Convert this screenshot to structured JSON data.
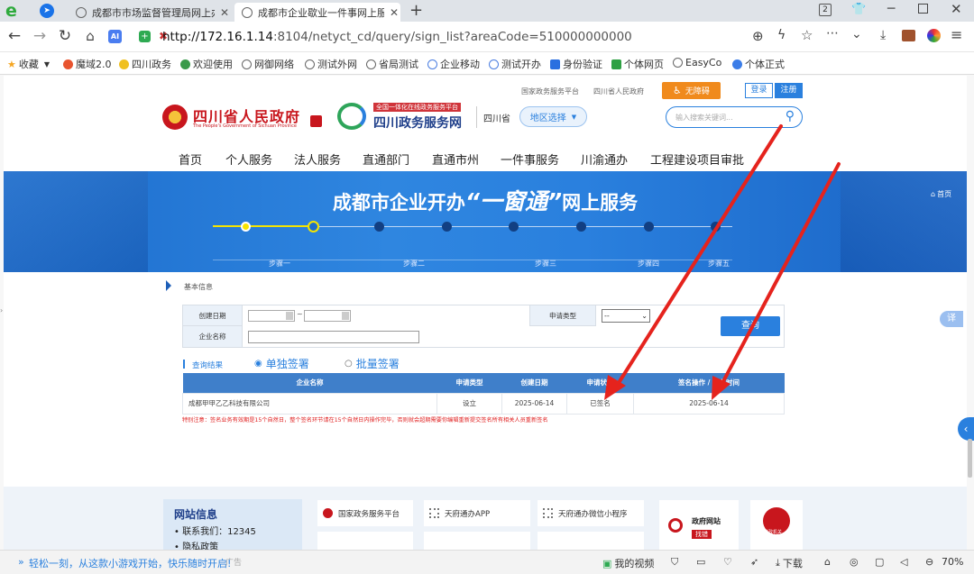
{
  "tabs": [
    {
      "title": "成都市市场监督管理局网上办事"
    },
    {
      "title": "成都市企业歇业一件事网上服务"
    }
  ],
  "window": {
    "new_tab": "+",
    "tab_count": "2"
  },
  "addressbar": {
    "url_bold": "http://172.16.1.14",
    "url_rest": ":8104/netyct_cd/query/sign_list?areaCode=510000000000"
  },
  "bookmarks": [
    {
      "label": "收藏",
      "icon": "star-icon"
    },
    {
      "label": "魔域2.0",
      "icon": "game-icon"
    },
    {
      "label": "四川政务",
      "icon": "gov-icon"
    },
    {
      "label": "欢迎使用",
      "icon": "shield-icon"
    },
    {
      "label": "网御网络",
      "icon": "globe-icon"
    },
    {
      "label": "测试外网",
      "icon": "globe-icon"
    },
    {
      "label": "省局测试",
      "icon": "globe-icon"
    },
    {
      "label": "企业移动",
      "icon": "globe-icon"
    },
    {
      "label": "测试开办",
      "icon": "globe-icon"
    },
    {
      "label": "身份验证",
      "icon": "id-icon"
    },
    {
      "label": "个体网页",
      "icon": "doc-icon"
    },
    {
      "label": "EasyCo",
      "icon": "globe-icon"
    },
    {
      "label": "个体正式",
      "icon": "person-icon"
    }
  ],
  "site": {
    "top_links": [
      "国家政务服务平台",
      "四川省人民政府"
    ],
    "accessibility": "无障碍",
    "login": "登录",
    "register": "注册",
    "gov_name": "四川省人民政府",
    "gov_name_en": "The People's Government of Sichuan Province",
    "platform_tag": "全国一体化在线政务服务平台",
    "platform_name": "四川政务服务网",
    "province": "四川省",
    "region_select": "地区选择",
    "search_placeholder": "输入搜索关键词...",
    "nav": [
      "首页",
      "个人服务",
      "法人服务",
      "直通部门",
      "直通市州",
      "一件事服务",
      "川渝通办",
      "工程建设项目审批"
    ]
  },
  "banner": {
    "title_a": "成都市企业开办",
    "title_b": "“一窗通”",
    "title_c": "网上服务",
    "home": "首页",
    "steps": [
      "步骤一",
      "步骤二",
      "步骤三",
      "步骤四",
      "步骤五"
    ]
  },
  "query": {
    "section": "基本信息",
    "created_date_label": "创建日期",
    "date_sep": "~",
    "apply_type_label": "申请类型",
    "apply_type_value": "--",
    "company_label": "企业名称",
    "search_button": "查询",
    "results_label": "查询结果",
    "mode_single": "单独签署",
    "mode_batch": "批量签署",
    "translate": "译"
  },
  "results": {
    "headers": [
      "企业名称",
      "申请类型",
      "创建日期",
      "申请状态",
      "签名操作 / 签名时间"
    ],
    "rows": [
      [
        "成都甲甲乙乙科技有限公司",
        "设立",
        "2025-06-14",
        "已签名",
        "2025-06-14"
      ]
    ],
    "notice": "特别注意：签名业务有效期是15个自然日，整个签名环节请在15个自然日内操作完毕，否则就会超期需要你编辑重新提交签名所有相关人员重新签名"
  },
  "footer": {
    "site_info": "网站信息",
    "contact": "联系我们：12345",
    "privacy": "隐私政策",
    "link_national": "国家政务服务平台",
    "link_app": "天府通办APP",
    "link_wechat": "天府通办微信小程序",
    "badge_gov_a": "政府网站",
    "badge_gov_b": "找错",
    "badge_police": "党政机关"
  },
  "statusbar": {
    "left_msg": "轻松一刻，从这款小游戏开始，快乐随时开启!",
    "ad": "广告",
    "videos": "我的视频",
    "download": "下载",
    "zoom": "70%"
  },
  "colors": {
    "primary_blue": "#2a80de",
    "table_header": "#3f7fca",
    "notice_red": "#e02020",
    "arrow_red": "#e5231d",
    "access_orange": "#f08a1c"
  }
}
